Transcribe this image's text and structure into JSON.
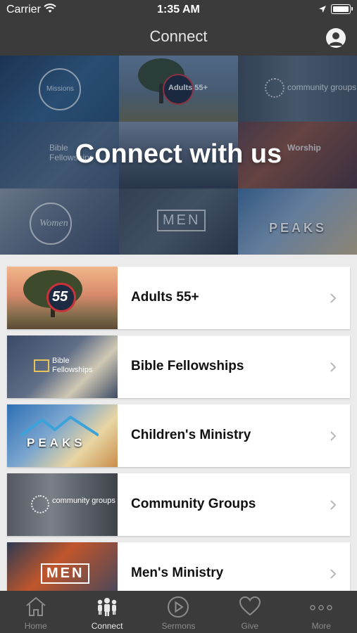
{
  "status_bar": {
    "carrier": "Carrier",
    "time": "1:35 AM"
  },
  "nav": {
    "title": "Connect",
    "profile_icon": "person-circle-icon"
  },
  "hero": {
    "heading": "Connect with us",
    "tiles": [
      "Missions",
      "Adults 55+",
      "community groups",
      "Bible Fellowships",
      "",
      "Worship",
      "Women",
      "MEN",
      "PEAKS"
    ]
  },
  "list": [
    {
      "label": "Adults 55+",
      "thumb_text": "55"
    },
    {
      "label": "Bible Fellowships",
      "thumb_text": "Bible Fellowships"
    },
    {
      "label": "Children's Ministry",
      "thumb_text": "PEAKS"
    },
    {
      "label": "Community Groups",
      "thumb_text": "community groups"
    },
    {
      "label": "Men's Ministry",
      "thumb_text": "MEN"
    }
  ],
  "tabs": [
    {
      "label": "Home",
      "icon": "home-icon",
      "active": false
    },
    {
      "label": "Connect",
      "icon": "people-icon",
      "active": true
    },
    {
      "label": "Sermons",
      "icon": "play-circle-icon",
      "active": false
    },
    {
      "label": "Give",
      "icon": "heart-icon",
      "active": false
    },
    {
      "label": "More",
      "icon": "more-dots-icon",
      "active": false
    }
  ],
  "colors": {
    "bar": "#3b3b3b",
    "text_dark": "#111111",
    "active_tab": "#e8e8e8",
    "inactive_tab": "#8c8c8c"
  }
}
